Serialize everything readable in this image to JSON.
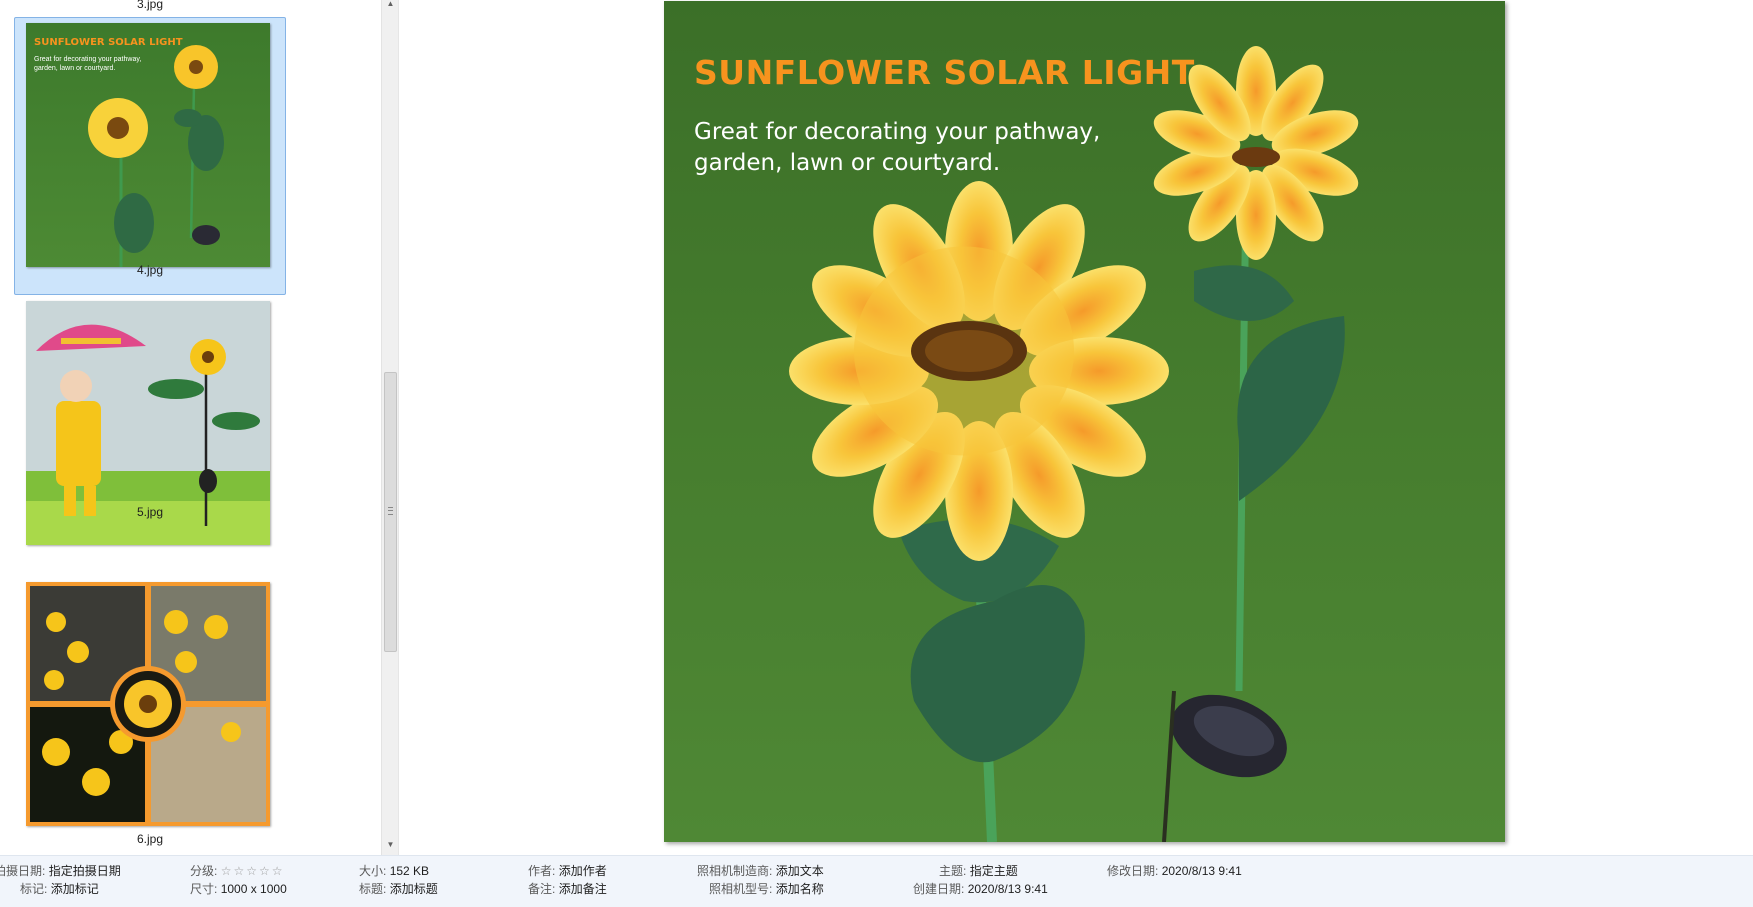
{
  "thumbnails": [
    {
      "label": "3.jpg"
    },
    {
      "label": "4.jpg",
      "selected": true,
      "image_text": {
        "title": "SUNFLOWER SOLAR LIGHT",
        "subtitle": "Great for decorating your pathway, garden, lawn or courtyard."
      }
    },
    {
      "label": "5.jpg"
    },
    {
      "label": "6.jpg"
    }
  ],
  "preview": {
    "title": "SUNFLOWER SOLAR LIGHT",
    "subtitle": "Great for decorating your pathway, garden, lawn or courtyard."
  },
  "details": {
    "date_taken": {
      "key": "拍摄日期:",
      "value": "指定拍摄日期"
    },
    "tags": {
      "key": "标记:",
      "value": "添加标记"
    },
    "rating": {
      "key": "分级:",
      "stars": "☆☆☆☆☆"
    },
    "dimensions": {
      "key": "尺寸:",
      "value": "1000 x 1000"
    },
    "size": {
      "key": "大小:",
      "value": "152 KB"
    },
    "title": {
      "key": "标题:",
      "value": "添加标题"
    },
    "author": {
      "key": "作者:",
      "value": "添加作者"
    },
    "comments": {
      "key": "备注:",
      "value": "添加备注"
    },
    "camera_maker": {
      "key": "照相机制造商:",
      "value": "添加文本"
    },
    "camera_model": {
      "key": "照相机型号:",
      "value": "添加名称"
    },
    "subject": {
      "key": "主题:",
      "value": "指定主题"
    },
    "date_created": {
      "key": "创建日期:",
      "value": "2020/8/13 9:41"
    },
    "date_modified": {
      "key": "修改日期:",
      "value": "2020/8/13 9:41"
    }
  },
  "colors": {
    "accent_orange": "#f7931e",
    "selection": "#cce4fb",
    "grass": "#3f7a2a"
  }
}
